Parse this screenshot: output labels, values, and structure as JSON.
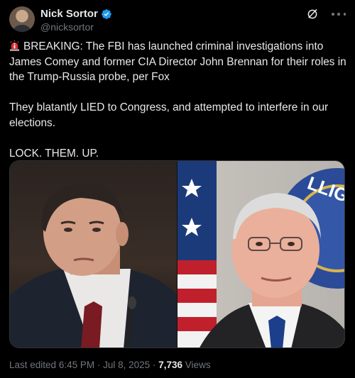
{
  "author": {
    "display_name": "Nick Sortor",
    "handle": "@nicksortor",
    "verified": true,
    "avatar_icon": "profile-photo"
  },
  "header_icons": [
    "grok-icon",
    "more-options-icon"
  ],
  "post": {
    "line1": "BREAKING: The FBI has launched criminal investigations into James Comey and former CIA Director John Brennan for their roles in the Trump-Russia probe, per Fox",
    "line2": "They blatantly LIED to Congress, and attempted to interfere in our elections.",
    "line3": "LOCK. THEM. UP.",
    "leading_emoji": "siren-emoji"
  },
  "media": {
    "photo_left": "photo of man in dark suit and red tie",
    "photo_right": "photo of man with glasses in front of US flag and CIA seal",
    "seal_text": "LLIGE"
  },
  "meta": {
    "edited_label": "Last edited",
    "time": "6:45 PM",
    "sep": "·",
    "date": "Jul 8, 2025",
    "views_count": "7,736",
    "views_label": "Views"
  },
  "colors": {
    "background": "#000000",
    "text": "#e7e9ea",
    "secondary": "#71767b",
    "verified_blue": "#1d9bf0"
  }
}
